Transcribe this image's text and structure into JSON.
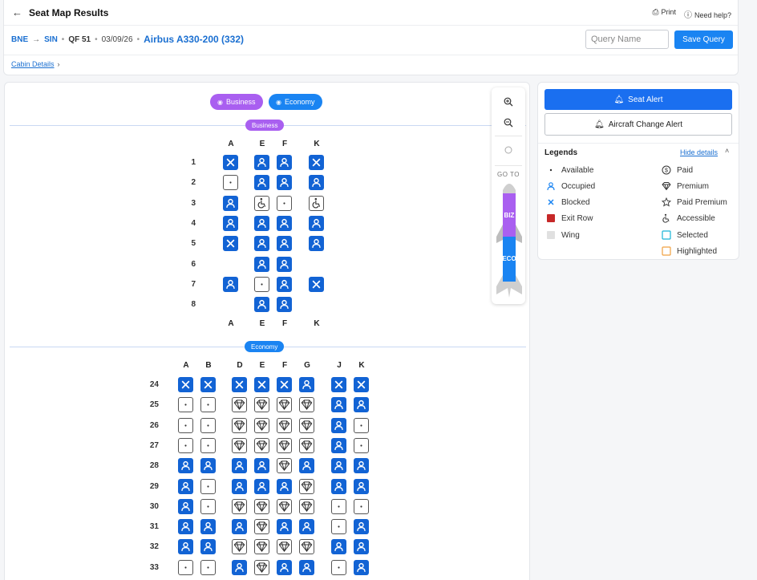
{
  "header": {
    "title": "Seat Map Results",
    "print_label": "Print",
    "help_label": "Need help?"
  },
  "route": {
    "origin": "BNE",
    "destination": "SIN",
    "flight": "QF 51",
    "date": "03/09/26",
    "aircraft": "Airbus A330-200 (332)"
  },
  "query": {
    "placeholder": "Query Name",
    "save_label": "Save Query"
  },
  "cabin_details_label": "Cabin Details",
  "filters": {
    "business": "Business",
    "economy": "Economy"
  },
  "sections": {
    "business": "Business",
    "economy": "Economy"
  },
  "nav": {
    "goto_label": "GO TO",
    "biz_label": "BIZ",
    "eco_label": "ECO"
  },
  "colors": {
    "business": "#a95ff0",
    "economy": "#1a84f2",
    "occupied": "#1263d4",
    "exit_row": "#c62828",
    "wing": "#e0e0e0",
    "selected": "#19b5d6",
    "highlighted": "#f0a040"
  },
  "business_cabin": {
    "columns": [
      "A",
      "E",
      "F",
      "K"
    ],
    "rows": [
      {
        "num": "1",
        "seats": [
          "blk",
          "occ",
          "occ",
          "blk"
        ]
      },
      {
        "num": "2",
        "seats": [
          "av",
          "occ",
          "occ",
          "occ"
        ]
      },
      {
        "num": "3",
        "seats": [
          "occ",
          "acc",
          "av",
          "acc"
        ]
      },
      {
        "num": "4",
        "seats": [
          "occ",
          "occ",
          "occ",
          "occ"
        ]
      },
      {
        "num": "5",
        "seats": [
          "blk",
          "occ",
          "occ",
          "occ"
        ]
      },
      {
        "num": "6",
        "seats": [
          "",
          "occ",
          "occ",
          ""
        ]
      },
      {
        "num": "7",
        "seats": [
          "occ",
          "av",
          "occ",
          "blk"
        ]
      },
      {
        "num": "8",
        "seats": [
          "",
          "occ",
          "occ",
          ""
        ]
      }
    ]
  },
  "economy_cabin": {
    "columns": [
      "A",
      "B",
      "D",
      "E",
      "F",
      "G",
      "J",
      "K"
    ],
    "rows": [
      {
        "num": "24",
        "seats": [
          "blk",
          "blk",
          "blk",
          "blk",
          "blk",
          "occ",
          "blk",
          "blk"
        ]
      },
      {
        "num": "25",
        "seats": [
          "av",
          "av",
          "prem",
          "prem",
          "prem",
          "prem",
          "occ",
          "occ"
        ]
      },
      {
        "num": "26",
        "seats": [
          "av",
          "av",
          "prem",
          "prem",
          "prem",
          "prem",
          "occ",
          "av"
        ]
      },
      {
        "num": "27",
        "seats": [
          "av",
          "av",
          "prem",
          "prem",
          "prem",
          "prem",
          "occ",
          "av"
        ]
      },
      {
        "num": "28",
        "seats": [
          "occ",
          "occ",
          "occ",
          "occ",
          "prem",
          "occ",
          "occ",
          "occ"
        ]
      },
      {
        "num": "29",
        "seats": [
          "occ",
          "av",
          "occ",
          "occ",
          "occ",
          "prem",
          "occ",
          "occ"
        ]
      },
      {
        "num": "30",
        "seats": [
          "occ",
          "av",
          "prem",
          "prem",
          "prem",
          "prem",
          "av",
          "av"
        ]
      },
      {
        "num": "31",
        "seats": [
          "occ",
          "occ",
          "occ",
          "prem",
          "occ",
          "occ",
          "av",
          "occ"
        ]
      },
      {
        "num": "32",
        "seats": [
          "occ",
          "occ",
          "prem",
          "prem",
          "prem",
          "prem",
          "occ",
          "occ"
        ]
      },
      {
        "num": "33",
        "seats": [
          "av",
          "av",
          "occ",
          "prem",
          "occ",
          "occ",
          "av",
          "occ"
        ]
      }
    ]
  },
  "alerts": {
    "seat_alert": "Seat Alert",
    "aircraft_change": "Aircraft Change Alert"
  },
  "legend": {
    "title": "Legends",
    "hide_label": "Hide details",
    "items": [
      {
        "label": "Available",
        "icon": "available-dot-icon"
      },
      {
        "label": "Occupied",
        "icon": "person-icon"
      },
      {
        "label": "Blocked",
        "icon": "x-icon"
      },
      {
        "label": "Exit Row",
        "icon": "exit-row-swatch"
      },
      {
        "label": "Wing",
        "icon": "wing-swatch"
      },
      {
        "label": "Paid",
        "icon": "dollar-circle-icon"
      },
      {
        "label": "Premium",
        "icon": "diamond-icon"
      },
      {
        "label": "Paid Premium",
        "icon": "star-icon"
      },
      {
        "label": "Accessible",
        "icon": "wheelchair-icon"
      },
      {
        "label": "Selected",
        "icon": "selected-swatch"
      },
      {
        "label": "Highlighted",
        "icon": "highlighted-swatch"
      }
    ]
  }
}
